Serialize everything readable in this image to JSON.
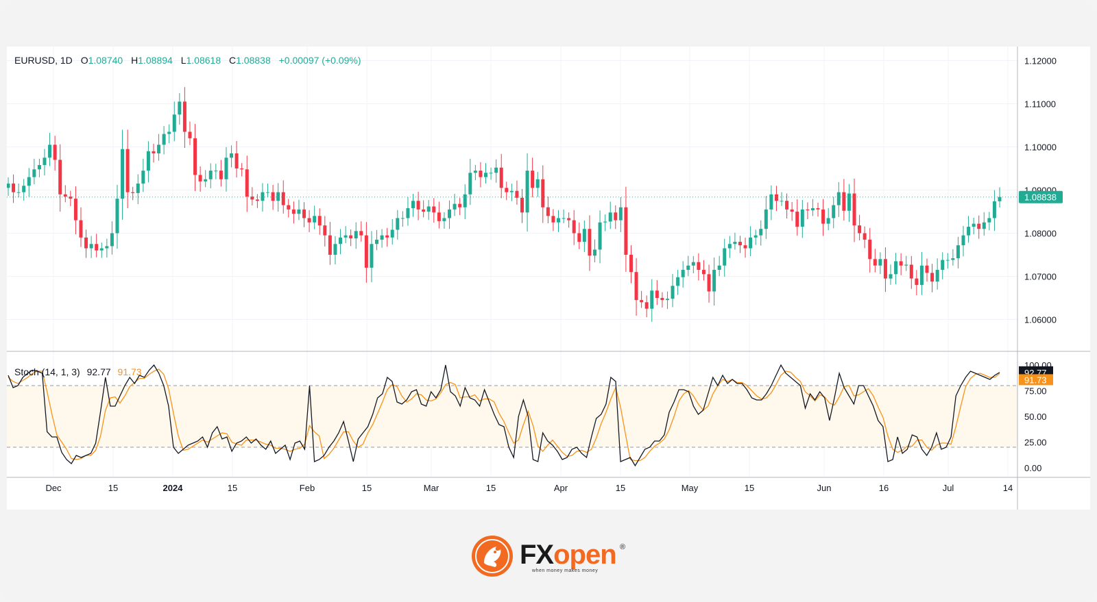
{
  "header": {
    "symbol": "EURUSD, 1D",
    "open_label": "O",
    "open": "1.08740",
    "high_label": "H",
    "high": "1.08894",
    "low_label": "L",
    "low": "1.08618",
    "close_label": "C",
    "close": "1.08838",
    "change": "+0.00097 (+0.09%)"
  },
  "stoch": {
    "label": "Stoch (14, 1, 3)",
    "k": "92.77",
    "d": "91.73"
  },
  "brand": {
    "fx": "FX",
    "open": "open",
    "reg": "®",
    "tagline": "when money makes money"
  },
  "colors": {
    "up": "#22ab94",
    "down": "#f23645",
    "k_line": "#131722",
    "d_line": "#f7931a",
    "band": "#fff8ec"
  },
  "chart_data": [
    {
      "type": "candlestick",
      "title": "EURUSD, 1D",
      "ylim": [
        1.0535,
        1.1235
      ],
      "yticks": [
        "1.12000",
        "1.11000",
        "1.10000",
        "1.09000",
        "1.08000",
        "1.07000",
        "1.06000"
      ],
      "last_price": "1.08838",
      "x_ticks": [
        "Dec",
        "15",
        "2024",
        "15",
        "Feb",
        "15",
        "Mar",
        "15",
        "Apr",
        "15",
        "May",
        "15",
        "Jun",
        "16",
        "Jul",
        "14"
      ],
      "closes": [
        1.0915,
        1.0895,
        1.0895,
        1.091,
        1.093,
        1.0948,
        1.0958,
        1.0975,
        1.1005,
        1.097,
        1.089,
        1.0885,
        1.088,
        1.083,
        1.079,
        1.0765,
        1.0775,
        1.076,
        1.0765,
        1.077,
        1.08,
        1.088,
        1.0995,
        1.0895,
        1.0893,
        1.0915,
        1.0945,
        1.099,
        1.0985,
        1.1005,
        1.103,
        1.1035,
        1.1075,
        1.1105,
        1.1035,
        1.102,
        1.0935,
        1.092,
        1.0925,
        1.0945,
        1.0945,
        1.0925,
        1.0975,
        1.0985,
        1.095,
        1.0948,
        1.0885,
        1.0878,
        1.0875,
        1.0895,
        1.0895,
        1.0875,
        1.0895,
        1.0865,
        1.0855,
        1.0845,
        1.0855,
        1.0835,
        1.0825,
        1.084,
        1.0818,
        1.0795,
        1.075,
        1.0775,
        1.079,
        1.0795,
        1.0788,
        1.0805,
        1.0795,
        1.072,
        1.0775,
        1.0785,
        1.0795,
        1.079,
        1.0808,
        1.0835,
        1.0835,
        1.0858,
        1.0875,
        1.0855,
        1.085,
        1.0862,
        1.0848,
        1.0828,
        1.0835,
        1.0855,
        1.0868,
        1.086,
        1.089,
        1.094,
        1.0945,
        1.093,
        1.094,
        1.094,
        1.0952,
        1.0905,
        1.0895,
        1.0898,
        1.0882,
        1.0848,
        1.0945,
        1.0905,
        1.0925,
        1.086,
        1.084,
        1.0825,
        1.0835,
        1.0835,
        1.083,
        1.08,
        1.078,
        1.081,
        1.0748,
        1.0762,
        1.0825,
        1.0827,
        1.0848,
        1.083,
        1.086,
        1.075,
        1.071,
        1.0645,
        1.064,
        1.0625,
        1.0667,
        1.065,
        1.0645,
        1.0648,
        1.0678,
        1.0698,
        1.0715,
        1.0725,
        1.0733,
        1.0715,
        1.0705,
        1.0665,
        1.0715,
        1.0725,
        1.0765,
        1.0775,
        1.078,
        1.0772,
        1.0765,
        1.079,
        1.0795,
        1.081,
        1.0855,
        1.089,
        1.0875,
        1.0875,
        1.0855,
        1.085,
        1.0815,
        1.0855,
        1.0853,
        1.0858,
        1.0855,
        1.0822,
        1.0835,
        1.0865,
        1.0895,
        1.0852,
        1.0892,
        1.0818,
        1.08,
        1.0785,
        1.074,
        1.0725,
        1.074,
        1.0695,
        1.0705,
        1.0735,
        1.0725,
        1.0727,
        1.0695,
        1.068,
        1.0725,
        1.0708,
        1.0688,
        1.0715,
        1.0738,
        1.0738,
        1.0742,
        1.0772,
        1.0795,
        1.0815,
        1.0822,
        1.081,
        1.0825,
        1.0835,
        1.0874,
        1.0884
      ]
    },
    {
      "type": "line",
      "title": "Stoch (14, 1, 3)",
      "ylim": [
        0,
        100
      ],
      "yticks": [
        "100.00",
        "75.00",
        "50.00",
        "25.00",
        "0.00"
      ],
      "bands": [
        20,
        80
      ],
      "series": [
        {
          "name": "%K",
          "last": 92.77,
          "values": [
            90,
            78,
            80,
            88,
            92,
            95,
            94,
            92,
            35,
            30,
            30,
            15,
            8,
            4,
            12,
            10,
            12,
            14,
            24,
            55,
            88,
            60,
            60,
            70,
            80,
            88,
            82,
            90,
            88,
            95,
            100,
            92,
            80,
            60,
            20,
            14,
            18,
            22,
            24,
            26,
            30,
            20,
            34,
            40,
            28,
            30,
            16,
            24,
            26,
            30,
            24,
            28,
            22,
            18,
            26,
            14,
            18,
            22,
            8,
            24,
            26,
            18,
            80,
            6,
            8,
            12,
            20,
            26,
            34,
            45,
            26,
            6,
            28,
            34,
            40,
            52,
            68,
            72,
            88,
            84,
            64,
            62,
            66,
            74,
            76,
            62,
            60,
            74,
            68,
            76,
            100,
            74,
            70,
            60,
            78,
            68,
            66,
            60,
            76,
            64,
            52,
            42,
            40,
            20,
            10,
            50,
            66,
            50,
            8,
            6,
            34,
            26,
            22,
            16,
            8,
            10,
            18,
            20,
            14,
            10,
            30,
            48,
            52,
            62,
            88,
            84,
            6,
            8,
            10,
            2,
            10,
            18,
            20,
            26,
            26,
            32,
            54,
            64,
            76,
            76,
            74,
            60,
            52,
            56,
            72,
            88,
            80,
            90,
            82,
            86,
            82,
            82,
            76,
            68,
            66,
            66,
            72,
            80,
            90,
            100,
            92,
            88,
            84,
            80,
            58,
            72,
            66,
            74,
            68,
            46,
            68,
            92,
            78,
            70,
            62,
            80,
            80,
            70,
            60,
            46,
            40,
            6,
            8,
            30,
            14,
            18,
            32,
            30,
            18,
            12,
            20,
            34,
            18,
            20,
            30,
            70,
            80,
            88,
            94,
            92,
            90,
            88,
            86,
            90,
            92.77
          ]
        },
        {
          "name": "%D",
          "last": 91.73,
          "values": [
            88,
            84,
            82,
            85,
            88,
            92,
            94,
            94,
            74,
            52,
            32,
            25,
            18,
            9,
            8,
            9,
            12,
            12,
            17,
            31,
            56,
            68,
            69,
            63,
            70,
            79,
            83,
            87,
            87,
            91,
            94,
            96,
            91,
            77,
            53,
            31,
            17,
            18,
            21,
            24,
            27,
            25,
            28,
            31,
            34,
            33,
            25,
            23,
            22,
            27,
            27,
            27,
            25,
            23,
            22,
            19,
            19,
            18,
            16,
            18,
            19,
            23,
            41,
            35,
            31,
            9,
            13,
            19,
            27,
            35,
            35,
            26,
            20,
            23,
            34,
            42,
            53,
            64,
            76,
            81,
            79,
            70,
            64,
            67,
            72,
            71,
            66,
            65,
            67,
            73,
            81,
            83,
            81,
            68,
            69,
            69,
            71,
            65,
            67,
            67,
            64,
            53,
            45,
            34,
            24,
            27,
            42,
            55,
            41,
            21,
            16,
            22,
            27,
            21,
            15,
            11,
            12,
            16,
            17,
            15,
            18,
            29,
            43,
            54,
            67,
            78,
            59,
            33,
            8,
            7,
            7,
            10,
            16,
            21,
            24,
            28,
            37,
            50,
            65,
            72,
            75,
            70,
            62,
            56,
            60,
            72,
            80,
            86,
            84,
            86,
            83,
            83,
            80,
            75,
            70,
            67,
            68,
            73,
            81,
            90,
            94,
            93,
            88,
            84,
            74,
            70,
            65,
            71,
            69,
            63,
            61,
            69,
            79,
            80,
            70,
            71,
            74,
            77,
            70,
            59,
            49,
            31,
            18,
            15,
            17,
            21,
            21,
            27,
            27,
            20,
            17,
            22,
            24,
            24,
            23,
            40,
            60,
            79,
            87,
            91,
            92,
            90,
            88,
            88,
            91.73
          ]
        }
      ]
    }
  ]
}
